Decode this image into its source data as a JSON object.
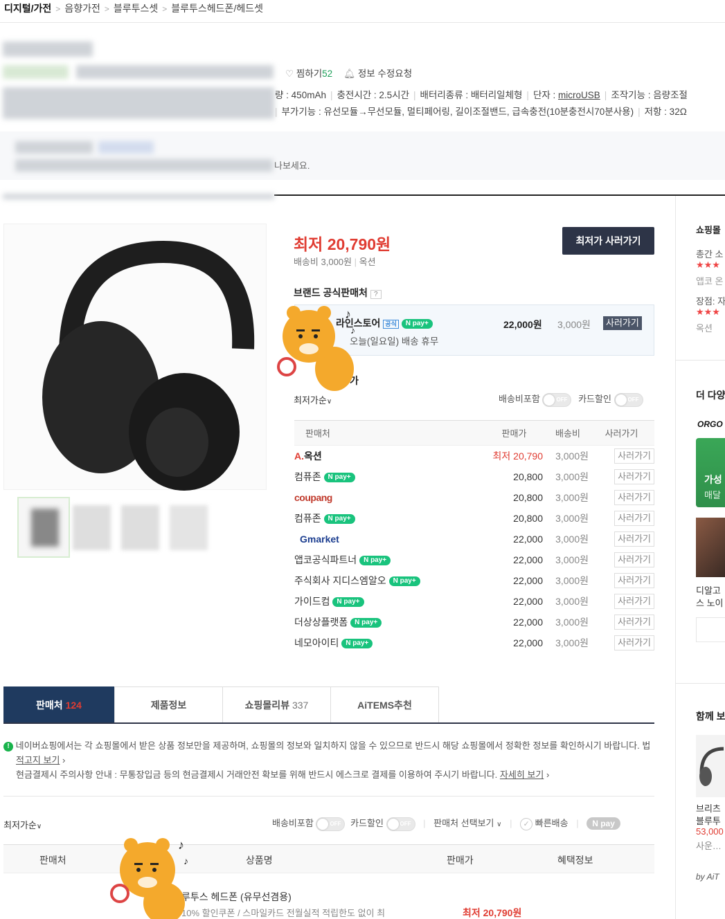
{
  "breadcrumb": [
    "디지털/가전",
    "음향가전",
    "블루투스셋",
    "블루투스헤드폰/헤드셋"
  ],
  "header": {
    "wish_label": "찜하기",
    "wish_count": "52",
    "edit_label": "정보 수정요청"
  },
  "specs": {
    "line1": [
      "량 : 450mAh",
      "충전시간 : 2.5시간",
      "배터리종류 : 배터리일체형",
      "단자 : ",
      "조작기능 : 음량조절"
    ],
    "terminal_value": "microUSB",
    "line2": "부가기능 : 유선모듈→무선모듈, 멀티페어링, 길이조절밴드, 급속충전(10분충전시70분사용)",
    "line2_b": "저항 : 32Ω"
  },
  "notice_suffix": "나보세요.",
  "price": {
    "lowest": "최저 20,790원",
    "shipping": "배송비 3,000원",
    "mall": "옥션",
    "buy_button": "최저가 사러가기"
  },
  "brand": {
    "title": "브랜드 공식판매처",
    "help": "?",
    "store_name": "라인스토어",
    "official_tag": "공식",
    "npay": "pay",
    "price": "22,000원",
    "shipping": "3,000원",
    "buy": "사러가기",
    "notice": "오늘(일요일) 배송 휴무"
  },
  "compare": {
    "title": "가",
    "sort": "최저가순",
    "ship_toggle": "배송비포함",
    "card_toggle": "카드할인",
    "off": "OFF"
  },
  "table": {
    "headers": [
      "판매처",
      "판매가",
      "배송비",
      "사러가기"
    ],
    "rows": [
      {
        "seller": "옥션",
        "logo": "auction",
        "price": "최저 20,790",
        "ship": "3,000원",
        "buy": "사러가기",
        "npay": false
      },
      {
        "seller": "컴퓨존",
        "logo": "",
        "price": "20,800",
        "ship": "3,000원",
        "buy": "사러가기",
        "npay": true
      },
      {
        "seller": "coupang",
        "logo": "coupang",
        "price": "20,800",
        "ship": "3,000원",
        "buy": "사러가기",
        "npay": false
      },
      {
        "seller": "컴퓨존",
        "logo": "",
        "price": "20,800",
        "ship": "3,000원",
        "buy": "사러가기",
        "npay": true
      },
      {
        "seller": "Gmarket",
        "logo": "gmarket",
        "price": "22,000",
        "ship": "3,000원",
        "buy": "사러가기",
        "npay": false
      },
      {
        "seller": "앱코공식파트너",
        "logo": "",
        "price": "22,000",
        "ship": "3,000원",
        "buy": "사러가기",
        "npay": true
      },
      {
        "seller": "주식회사 지디스엠알오",
        "logo": "",
        "price": "22,000",
        "ship": "3,000원",
        "buy": "사러가기",
        "npay": true
      },
      {
        "seller": "가이드컴",
        "logo": "",
        "price": "22,000",
        "ship": "3,000원",
        "buy": "사러가기",
        "npay": true
      },
      {
        "seller": "더상상플랫폼",
        "logo": "",
        "price": "22,000",
        "ship": "3,000원",
        "buy": "사러가기",
        "npay": true
      },
      {
        "seller": "네모아이티",
        "logo": "",
        "price": "22,000",
        "ship": "3,000원",
        "buy": "사러가기",
        "npay": true
      }
    ]
  },
  "tabs": [
    {
      "label": "판매처",
      "count": "124"
    },
    {
      "label": "제품정보",
      "count": ""
    },
    {
      "label": "쇼핑몰리뷰",
      "count": "337"
    },
    {
      "label": "AiTEMS추천",
      "count": ""
    }
  ],
  "info": {
    "line1": "네이버쇼핑에서는 각 쇼핑몰에서 받은 상품 정보만을 제공하며, 쇼핑몰의 정보와 일치하지 않을 수 있으므로 반드시 해당 쇼핑몰에서 정확한 정보를 확인하시기 바랍니다.",
    "line1_tail": "법",
    "line1_link": "적고지 보기",
    "line2": "현금결제시 주의사항 안내 : 무통장입금 등의 현금결제시 거래안전 확보를 위해 반드시 에스크로 결제를 이용하여 주시기 바랍니다.",
    "line2_link": "자세히 보기"
  },
  "filter2": {
    "sort": "최저가순",
    "ship": "배송비포함",
    "card": "카드할인",
    "seller_view": "판매처 선택보기",
    "fast": "빠른배송",
    "npay": "pay",
    "off": "OFF"
  },
  "bottom_table": {
    "headers": [
      "판매처",
      "상품명",
      "판매가",
      "혜택정보"
    ],
    "row_title": "루투스 헤드폰 (유무선겸용)",
    "row_desc": "10% 할인쿠폰 / 스마일카드 전월실적 적립한도 없이 최",
    "row_price": "최저 20,790원"
  },
  "right": {
    "t1": "쇼핑몰",
    "r1": "총간 소",
    "r1b": "앱코 온",
    "r2": "장점: 자",
    "r2b": "옥션",
    "t2": "더 다양",
    "brand": "ORGO",
    "banner1": "가성",
    "banner2": "매달",
    "cap1": "디알고",
    "cap2": "스 노이",
    "t3": "함께 보",
    "p1": "브리츠",
    "p2": "블루투",
    "p3": "53,000",
    "p4": "사운…",
    "by": "by AiT"
  }
}
